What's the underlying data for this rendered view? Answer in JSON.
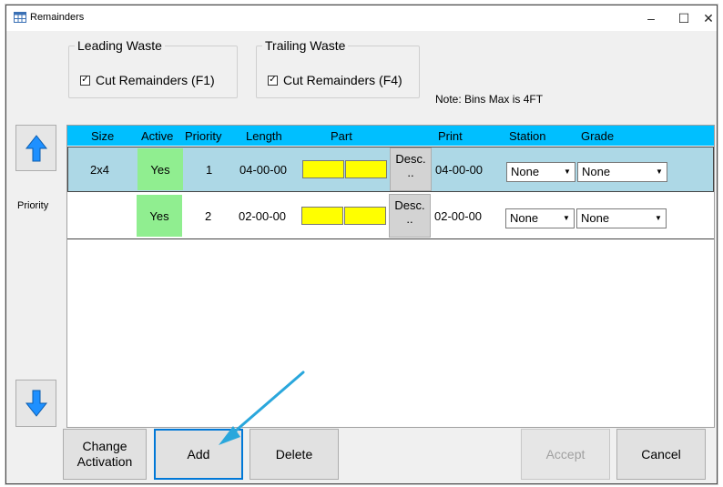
{
  "window": {
    "title": "Remainders",
    "minimize": "–",
    "maximize": "☐",
    "close": "✕"
  },
  "leading_waste": {
    "legend": "Leading Waste",
    "checkbox_label": "Cut Remainders (F1)",
    "checked": true
  },
  "trailing_waste": {
    "legend": "Trailing Waste",
    "checkbox_label": "Cut Remainders (F4)",
    "checked": true
  },
  "note": "Note: Bins Max is 4FT",
  "check_glyph": "✓",
  "sidebar": {
    "priority_label": "Priority"
  },
  "table": {
    "headers": {
      "size": "Size",
      "active": "Active",
      "priority": "Priority",
      "length": "Length",
      "part": "Part",
      "print": "Print",
      "station": "Station",
      "grade": "Grade"
    },
    "rows": [
      {
        "size": "2x4",
        "active": "Yes",
        "priority": "1",
        "length": "04-00-00",
        "desc_label": "Desc.",
        "desc_dots": "..",
        "print": "04-00-00",
        "station": "None",
        "grade": "None"
      },
      {
        "size": "",
        "active": "Yes",
        "priority": "2",
        "length": "02-00-00",
        "desc_label": "Desc.",
        "desc_dots": "..",
        "print": "02-00-00",
        "station": "None",
        "grade": "None"
      }
    ]
  },
  "buttons": {
    "change_activation_line1": "Change",
    "change_activation_line2": "Activation",
    "add": "Add",
    "delete": "Delete",
    "accept": "Accept",
    "cancel": "Cancel"
  },
  "colors": {
    "header_bg": "#00bfff",
    "selected_row_bg": "#add8e6",
    "active_cell_bg": "#90ee90",
    "part_box_bg": "#ffff00",
    "arrow_blue": "#1e90ff",
    "annotation_arrow": "#2aa7dc"
  },
  "icons": {
    "up": "arrow-up-icon",
    "down": "arrow-down-icon",
    "app": "grid-table-icon",
    "dropdown": "dropdown-arrow-icon"
  }
}
